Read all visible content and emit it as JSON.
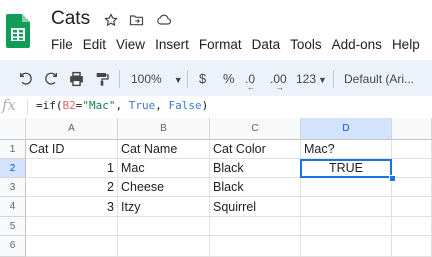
{
  "doc": {
    "title": "Cats"
  },
  "menu": [
    "File",
    "Edit",
    "View",
    "Insert",
    "Format",
    "Data",
    "Tools",
    "Add-ons",
    "Help"
  ],
  "toolbar": {
    "zoom": "100%",
    "currency": "$",
    "percent": "%",
    "decrease_decimal": ".0",
    "increase_decimal": ".00",
    "more_formats": "123",
    "font": "Default (Ari..."
  },
  "formula_bar": {
    "fx_label": "fx",
    "formula": {
      "prefix": "=if(",
      "ref": "B2",
      "eq": "=",
      "str": "\"Mac\"",
      "comma1": ", ",
      "true_kw": "True",
      "comma2": ", ",
      "false_kw": "False",
      "suffix": ")"
    }
  },
  "grid": {
    "columns": [
      "A",
      "B",
      "C",
      "D"
    ],
    "rows": [
      "1",
      "2",
      "3",
      "4",
      "5",
      "6"
    ],
    "cells": {
      "A1": "Cat ID",
      "B1": "Cat Name",
      "C1": "Cat Color",
      "D1": "Mac?",
      "A2": "1",
      "B2": "Mac",
      "C2": "Black",
      "D2": "TRUE",
      "A3": "2",
      "B3": "Cheese",
      "C3": "Black",
      "A4": "3",
      "B4": "Itzy",
      "C4": "Squirrel"
    },
    "selected_cell": "D2"
  },
  "colors": {
    "accent": "#1a73e8",
    "sheets_green": "#0f9d58",
    "toolbar_bg": "#edf2fa"
  }
}
